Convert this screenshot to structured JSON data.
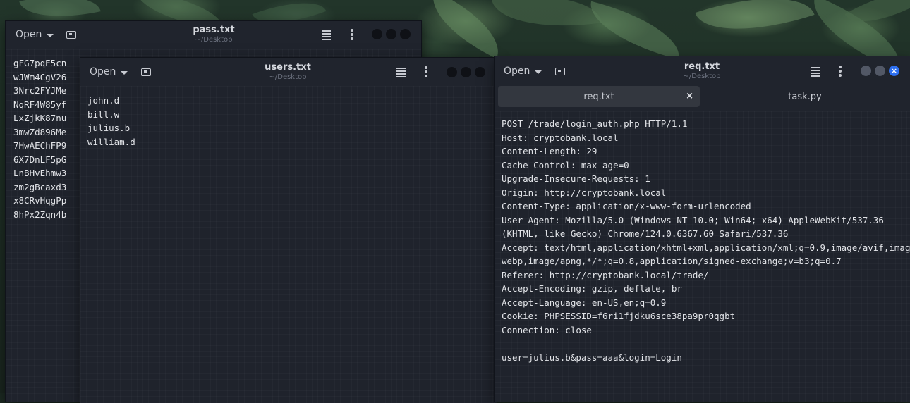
{
  "windows": {
    "pass": {
      "open_label": "Open",
      "title": "pass.txt",
      "subtitle": "~/Desktop",
      "lines": [
        "gFG7pqE5cn",
        "wJWm4CgV26",
        "3Nrc2FYJMe",
        "NqRF4W85yf",
        "LxZjkK87nu",
        "3mwZd896Me",
        "7HwAEChFP9",
        "6X7DnLF5pG",
        "LnBHvEhmw3",
        "zm2gBcaxd3",
        "x8CRvHqgPp",
        "8hPx2Zqn4b"
      ]
    },
    "users": {
      "open_label": "Open",
      "title": "users.txt",
      "subtitle": "~/Desktop",
      "lines": [
        "john.d",
        "bill.w",
        "julius.b",
        "william.d"
      ]
    },
    "req": {
      "open_label": "Open",
      "title": "req.txt",
      "subtitle": "~/Desktop",
      "tabs": [
        {
          "label": "req.txt",
          "active": true,
          "close": "×"
        },
        {
          "label": "task.py",
          "active": false
        }
      ],
      "lines": [
        "POST /trade/login_auth.php HTTP/1.1",
        "Host: cryptobank.local",
        "Content-Length: 29",
        "Cache-Control: max-age=0",
        "Upgrade-Insecure-Requests: 1",
        "Origin: http://cryptobank.local",
        "Content-Type: application/x-www-form-urlencoded",
        "User-Agent: Mozilla/5.0 (Windows NT 10.0; Win64; x64) AppleWebKit/537.36",
        "(KHTML, like Gecko) Chrome/124.0.6367.60 Safari/537.36",
        "Accept: text/html,application/xhtml+xml,application/xml;q=0.9,image/avif,image/",
        "webp,image/apng,*/*;q=0.8,application/signed-exchange;v=b3;q=0.7",
        "Referer: http://cryptobank.local/trade/",
        "Accept-Encoding: gzip, deflate, br",
        "Accept-Language: en-US,en;q=0.9",
        "Cookie: PHPSESSID=f6ri1fjdku6sce38pa9pr0qgbt",
        "Connection: close",
        "",
        "user=julius.b&pass=aaa&login=Login"
      ]
    }
  },
  "colors": {
    "editor_bg": "#1f232c",
    "header_bg": "#20242d",
    "text": "#e2e4e8",
    "close_button": "#2d6ff0"
  }
}
